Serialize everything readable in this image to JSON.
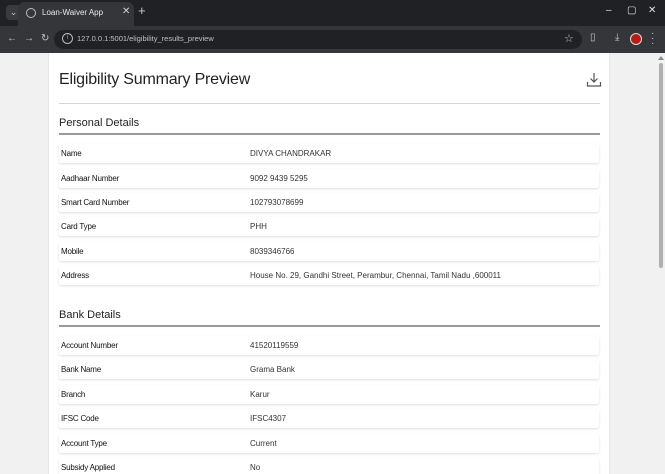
{
  "browser": {
    "tab_title": "Loan-Waiver App",
    "url": "127.0.0.1:5001/eligibility_results_preview",
    "tab_close": "✕",
    "new_tab": "+",
    "window_controls": [
      "–",
      "▢",
      "✕"
    ]
  },
  "page": {
    "title": "Eligibility Summary Preview",
    "download_icon": "download-icon"
  },
  "personal": {
    "heading": "Personal Details",
    "rows": [
      {
        "label": "Name",
        "value": "DIVYA CHANDRAKAR"
      },
      {
        "label": "Aadhaar Number",
        "value": "9092 9439 5295"
      },
      {
        "label": "Smart Card Number",
        "value": "102793078699"
      },
      {
        "label": "Card Type",
        "value": "PHH"
      },
      {
        "label": "Mobile",
        "value": "8039346766"
      },
      {
        "label": "Address",
        "value": "House No. 29, Gandhi Street, Perambur, Chennai, Tamil Nadu ,600011"
      }
    ]
  },
  "bank": {
    "heading": "Bank Details",
    "rows": [
      {
        "label": "Account Number",
        "value": "41520119559"
      },
      {
        "label": "Bank Name",
        "value": "Grama Bank"
      },
      {
        "label": "Branch",
        "value": "Karur"
      },
      {
        "label": "IFSC Code",
        "value": "IFSC4307"
      },
      {
        "label": "Account Type",
        "value": "Current"
      },
      {
        "label": "Subsidy Applied",
        "value": "No"
      }
    ]
  }
}
